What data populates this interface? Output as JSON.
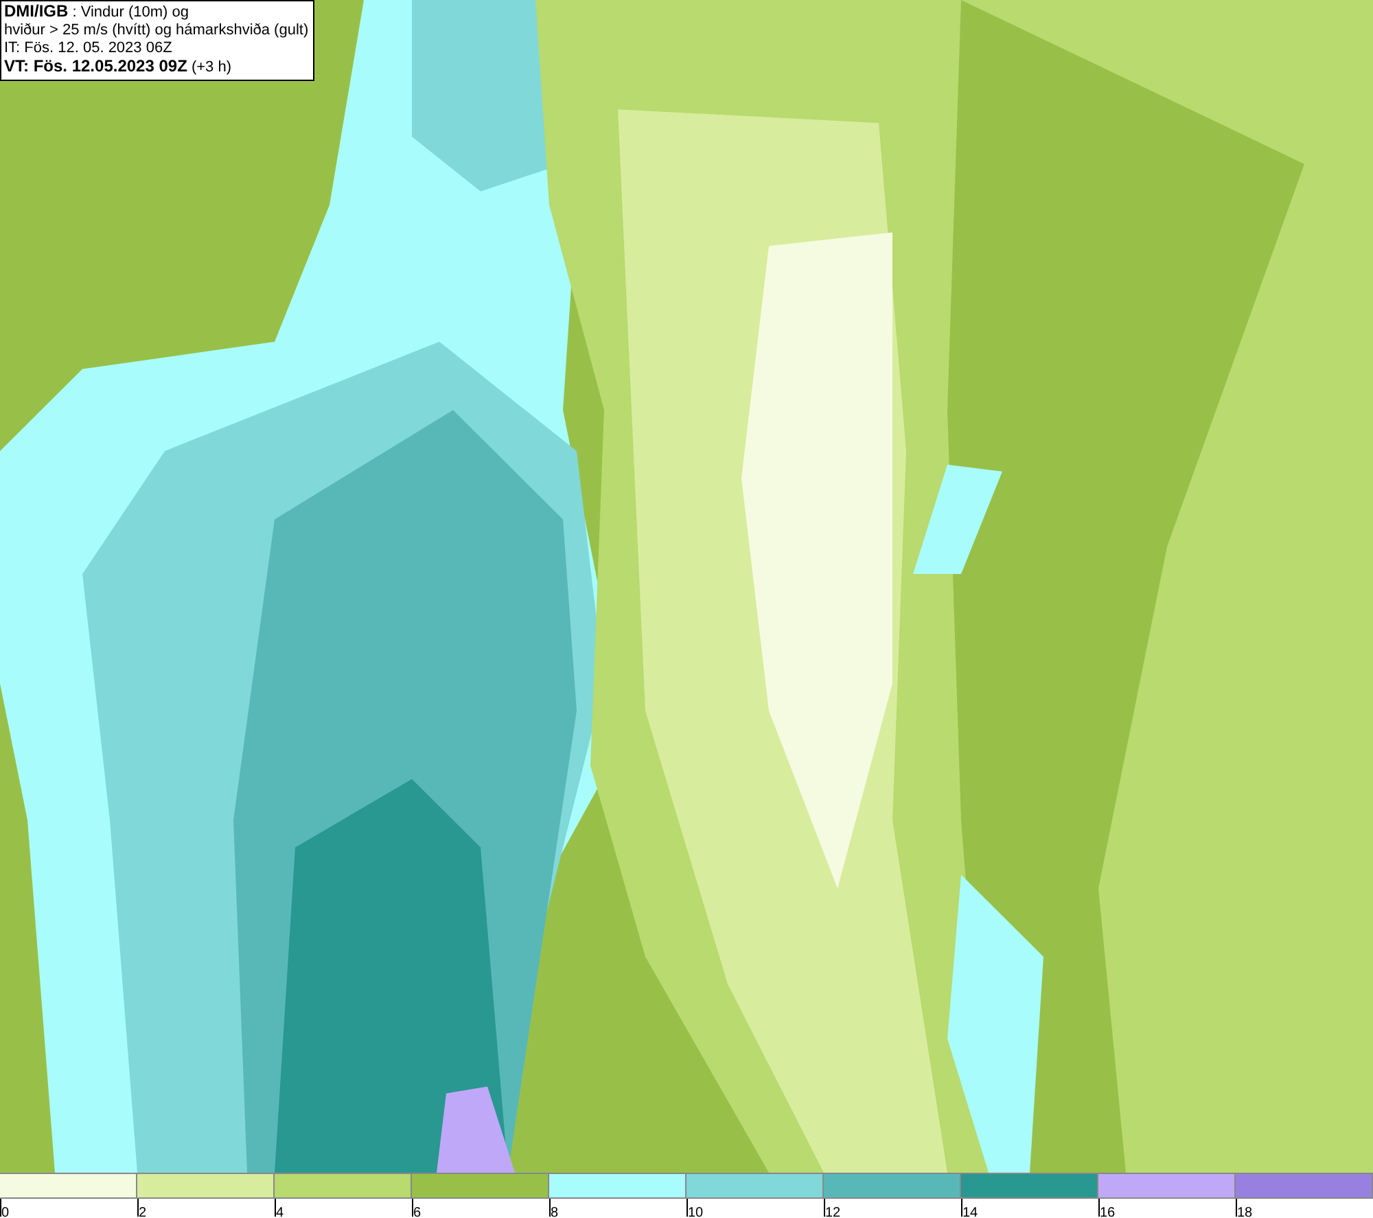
{
  "info_box": {
    "lines": [
      "**DMI/IGB** : Vindur (10m) og",
      "hviður > 25 m/s (hvítt) og hámarkshviða (gult)",
      "IT: Fös. 12. 05. 2023 06Z",
      "**VT: Fös. 12.05.2023 09Z** (+3 h)"
    ]
  },
  "legend": {
    "segments": [
      {
        "color": "#f5fbe0"
      },
      {
        "color": "#d8ec9e"
      },
      {
        "color": "#b8da6e"
      },
      {
        "color": "#98c048"
      },
      {
        "color": "#a8fcfc"
      },
      {
        "color": "#80d8d8"
      },
      {
        "color": "#58b8b8"
      },
      {
        "color": "#289890"
      },
      {
        "color": "#c0a8f8"
      },
      {
        "color": "#9880e0"
      }
    ],
    "labels": [
      "0",
      "2",
      "4",
      "6",
      "8",
      "10",
      "12",
      "14",
      "16",
      "18"
    ]
  }
}
